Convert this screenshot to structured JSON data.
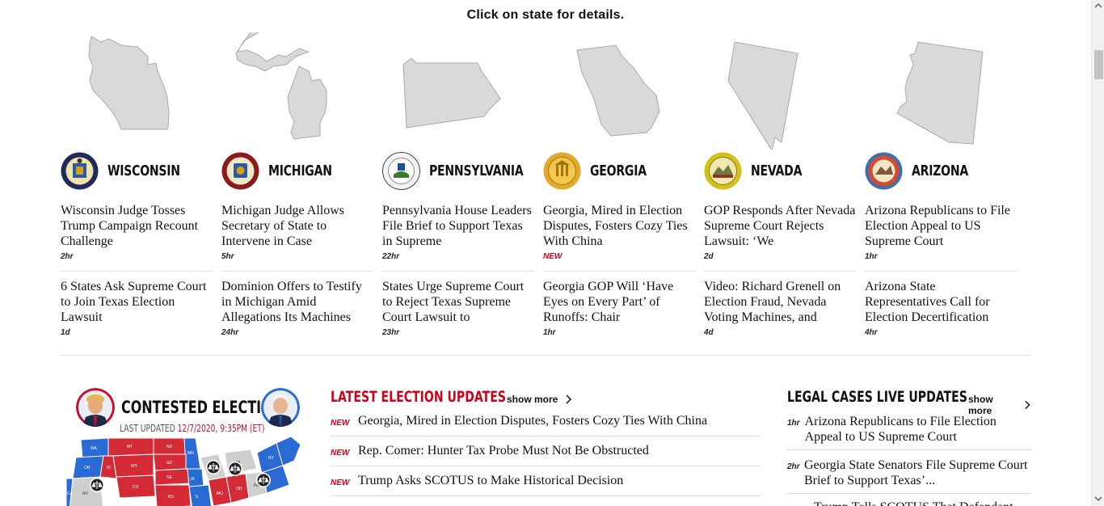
{
  "header": {
    "hint": "Click on state for details."
  },
  "states": [
    {
      "name": "WISCONSIN",
      "stories": [
        {
          "title": "Wisconsin Judge Tosses Trump Campaign Recount Challenge",
          "time": "2hr"
        },
        {
          "title": "6 States Ask Supreme Court to Join Texas Election Lawsuit",
          "time": "1d"
        }
      ]
    },
    {
      "name": "MICHIGAN",
      "stories": [
        {
          "title": "Michigan Judge Allows Secretary of State to Intervene in Case",
          "time": "5hr"
        },
        {
          "title": "Dominion Offers to Testify in Michigan Amid Allegations Its Machines",
          "time": "24hr"
        }
      ]
    },
    {
      "name": "PENNSYLVANIA",
      "stories": [
        {
          "title": "Pennsylvania House Leaders File Brief to Support Texas in Supreme",
          "time": "22hr"
        },
        {
          "title": "States Urge Supreme Court to Reject Texas Supreme Court Lawsuit to",
          "time": "23hr"
        }
      ]
    },
    {
      "name": "GEORGIA",
      "stories": [
        {
          "title": "Georgia, Mired in Election Disputes, Fosters Cozy Ties With China",
          "time": "NEW"
        },
        {
          "title": "Georgia GOP Will ‘Have Eyes on Every Part’ of Runoffs: Chair",
          "time": "1hr"
        }
      ]
    },
    {
      "name": "NEVADA",
      "stories": [
        {
          "title": "GOP Responds After Nevada Supreme Court Rejects Lawsuit: ‘We",
          "time": "2d"
        },
        {
          "title": "Video: Richard Grenell on Election Fraud, Nevada Voting Machines, and",
          "time": "4d"
        }
      ]
    },
    {
      "name": "ARIZONA",
      "stories": [
        {
          "title": "Arizona Republicans to File Election Appeal to US Supreme Court",
          "time": "1hr"
        },
        {
          "title": "Arizona State Representatives Call for Election Decertification",
          "time": "4hr"
        }
      ]
    }
  ],
  "contested": {
    "title": "CONTESTED ELECTION",
    "updated_label": "LAST UPDATED",
    "updated_time": "12/7/2020, 9:35PM (ET)",
    "map_labels": [
      "WA",
      "MT",
      "ND",
      "MN",
      "WI",
      "MI",
      "OR",
      "ID",
      "SD",
      "IA",
      "NY",
      "NV",
      "WY",
      "NE",
      "IL",
      "PA",
      "UT",
      "CO",
      "KS",
      "MO",
      "OH",
      "CA",
      "IN"
    ]
  },
  "latest": {
    "title": "LATEST ELECTION UPDATES",
    "show_more": "show more",
    "items": [
      {
        "badge": "NEW",
        "title": "Georgia, Mired in Election Disputes, Fosters Cozy Ties With China"
      },
      {
        "badge": "NEW",
        "title": "Rep. Comer: Hunter Tax Probe Must Not Be Obstructed"
      },
      {
        "badge": "NEW",
        "title": "Trump Asks SCOTUS to Make Historical Decision"
      }
    ]
  },
  "legal": {
    "title": "LEGAL CASES LIVE UPDATES",
    "show_more": "show more",
    "items": [
      {
        "time": "1hr",
        "title": "Arizona Republicans to File Election Appeal to US Supreme Court"
      },
      {
        "time": "2hr",
        "title": "Georgia State Senators File Supreme Court Brief to Support Texas’..."
      },
      {
        "time": "",
        "title": "Trump Tells SCOTUS That Defendant"
      }
    ]
  },
  "colors": {
    "accent_red": "#d0021b",
    "republican": "#d42a35",
    "democrat": "#2a6ad4",
    "contested": "#cfcfcf",
    "state_gray": "#d9d9d9"
  }
}
